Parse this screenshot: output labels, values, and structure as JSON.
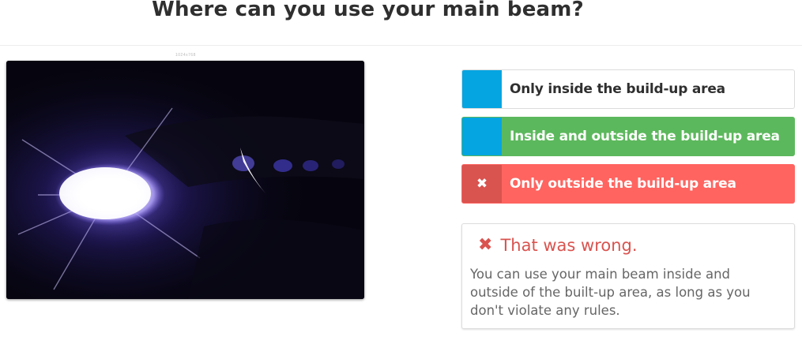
{
  "question": {
    "title": "Where can you use your main beam?"
  },
  "image": {
    "caption": "1024x768"
  },
  "answers": [
    {
      "label": "Only inside the build-up area",
      "state": "default",
      "marker_color": "#05a5e1",
      "background": "#ffffff"
    },
    {
      "label": "Inside and outside the build-up area",
      "state": "correct",
      "marker_color": "#05a5e1",
      "background": "#5cb85c"
    },
    {
      "label": "Only outside the build-up area",
      "state": "selected-wrong",
      "marker_icon": "close-icon",
      "marker_symbol": "✖",
      "marker_color": "#d9534f",
      "background": "#ff6460"
    }
  ],
  "feedback": {
    "icon": "close-icon",
    "icon_symbol": "✖",
    "heading": "That was wrong.",
    "text": "You can use your main beam inside and outside of the built-up area, as long as you don't violate any rules.",
    "color": "#d9534f"
  }
}
